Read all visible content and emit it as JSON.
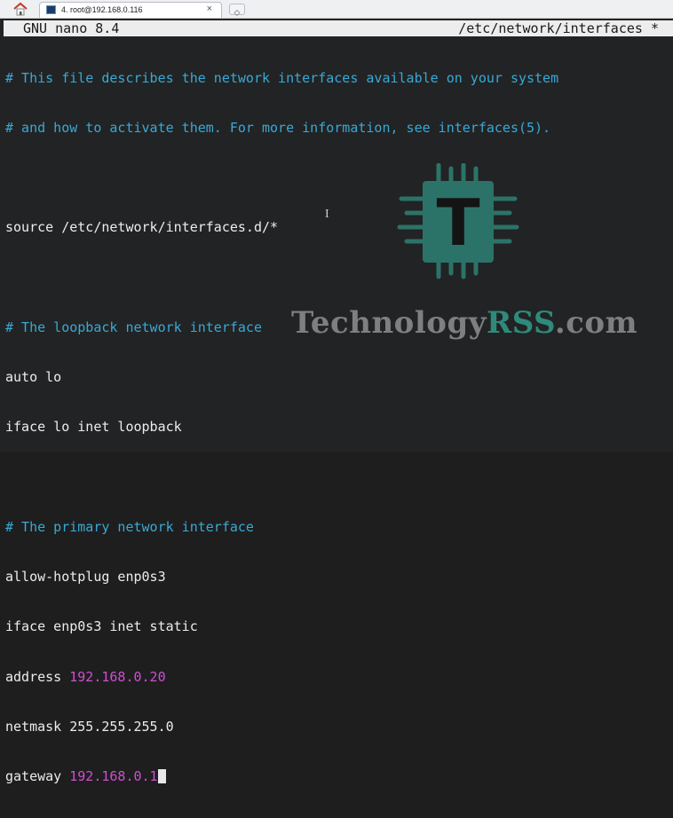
{
  "tabbar": {
    "home_icon": "home-icon",
    "tab_label": "4. root@192.168.0.116",
    "tab_close": "×"
  },
  "nano": {
    "title_left": "GNU nano 8.4",
    "title_right": "/etc/network/interfaces *"
  },
  "file": {
    "comment1": "# This file describes the network interfaces available on your system",
    "comment2": "# and how to activate them. For more information, see interfaces(5).",
    "source": "source /etc/network/interfaces.d/*",
    "comment3": "# The loopback network interface",
    "auto_lo": "auto lo",
    "iface_lo": "iface lo inet loopback",
    "comment4": "# The primary network interface",
    "allow_hotplug": "allow-hotplug enp0s3",
    "iface_enp": "iface enp0s3 inet static",
    "address_key": "address ",
    "address_val": "192.168.0.20",
    "netmask": "netmask 255.255.255.0",
    "gateway_key": "gateway ",
    "gateway_val": "192.168.0.1"
  },
  "cursor_glyph": "I",
  "watermark": {
    "logo_letter": "T",
    "text_main": "Technology",
    "text_accent": "RSS",
    "text_tail": ".com"
  },
  "colors": {
    "comment": "#38a9d6",
    "ip": "#d04ed4",
    "teal": "#2e8a7c"
  }
}
